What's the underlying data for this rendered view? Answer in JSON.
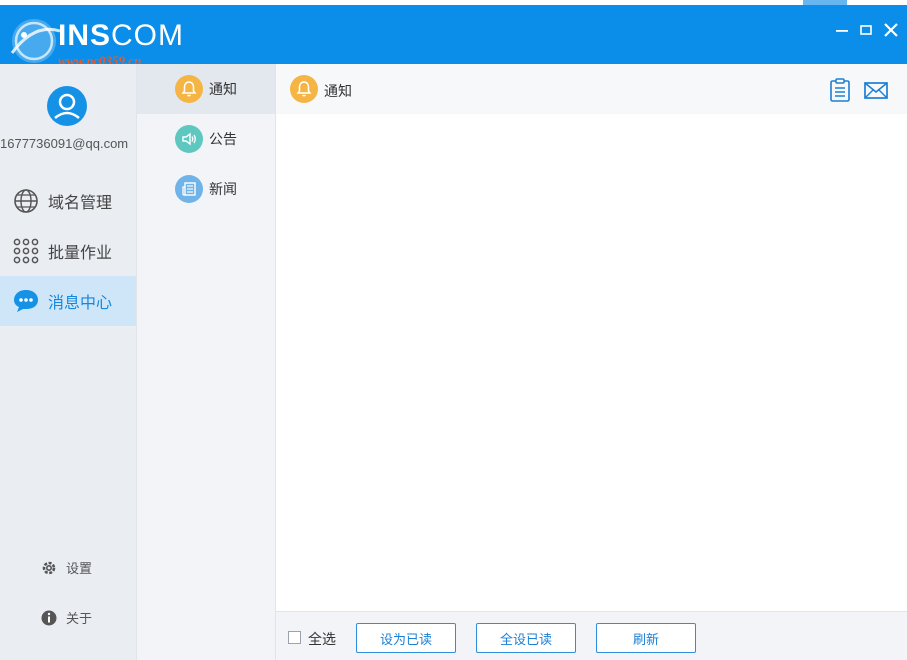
{
  "app": {
    "logo_main": "INS",
    "logo_thin": "COM",
    "watermark": "www.pc0359.cn"
  },
  "window_controls": {
    "minimize": "—",
    "maximize": "□",
    "close": "✕"
  },
  "sidebar": {
    "email": "1677736091@qq.com",
    "items": [
      {
        "label": "域名管理",
        "icon": "globe-icon"
      },
      {
        "label": "批量作业",
        "icon": "grid-dots-icon"
      },
      {
        "label": "消息中心",
        "icon": "chat-bubble-icon",
        "active": true
      }
    ],
    "settings_label": "设置",
    "about_label": "关于"
  },
  "categories": [
    {
      "label": "通知",
      "icon": "bell-icon",
      "color": "#f5b544",
      "active": true
    },
    {
      "label": "公告",
      "icon": "speaker-icon",
      "color": "#5ec8c0"
    },
    {
      "label": "新闻",
      "icon": "newspaper-icon",
      "color": "#6fb3e8"
    }
  ],
  "content": {
    "title": "通知",
    "footer": {
      "select_all": "全选",
      "mark_read": "设为已读",
      "mark_all_read": "全设已读",
      "refresh": "刷新"
    }
  },
  "colors": {
    "accent": "#0b8ee9",
    "active_text": "#1488df",
    "button_border": "#2f8fdc"
  }
}
